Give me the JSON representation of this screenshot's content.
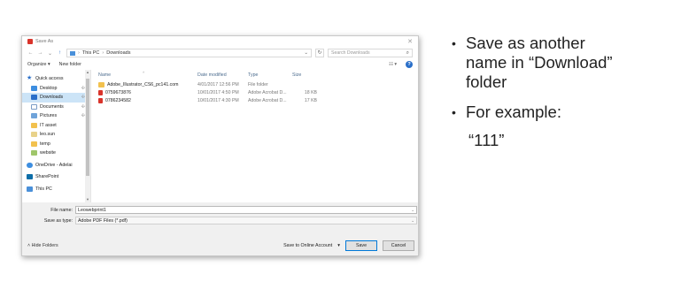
{
  "dialog": {
    "title": "Save As",
    "nav": {
      "back": "←",
      "forward": "→",
      "recent": "⌄",
      "up": "↑",
      "breadcrumb": [
        "This PC",
        "Downloads"
      ],
      "separator": "›",
      "refresh": "↻",
      "search_placeholder": "Search Downloads"
    },
    "toolbar": {
      "organize": "Organize ▾",
      "new_folder": "New folder",
      "view": "☷ ▾",
      "help": "?"
    },
    "sidebar": [
      {
        "label": "Quick access",
        "icon": "star-icon",
        "group": true
      },
      {
        "label": "Desktop",
        "icon": "desktop-icon",
        "pinned": true
      },
      {
        "label": "Downloads",
        "icon": "downloads-icon",
        "pinned": true,
        "selected": true
      },
      {
        "label": "Documents",
        "icon": "documents-icon",
        "pinned": true
      },
      {
        "label": "Pictures",
        "icon": "pictures-icon",
        "pinned": true
      },
      {
        "label": "IT asset",
        "icon": "folder-icon"
      },
      {
        "label": "leo.sun",
        "icon": "user-folder-icon"
      },
      {
        "label": "temp",
        "icon": "folder-icon"
      },
      {
        "label": "website",
        "icon": "web-folder-icon"
      },
      {
        "label": "OneDrive - Adelai",
        "icon": "onedrive-icon",
        "group": true
      },
      {
        "label": "SharePoint",
        "icon": "sharepoint-icon",
        "group": true
      },
      {
        "label": "This PC",
        "icon": "this-pc-icon",
        "group": true
      }
    ],
    "columns": {
      "name": "Name",
      "date": "Date modified",
      "type": "Type",
      "size": "Size"
    },
    "files": [
      {
        "name": "Adobe_Illustrator_CS6_pc141.com",
        "date": "4/01/2017 12:56 PM",
        "type": "File folder",
        "size": "",
        "icon": "folder-icon"
      },
      {
        "name": "0759673876",
        "date": "10/01/2017 4:50 PM",
        "type": "Adobe Acrobat D...",
        "size": "18 KB",
        "icon": "pdf-icon"
      },
      {
        "name": "0786234582",
        "date": "10/01/2017 4:30 PM",
        "type": "Adobe Acrobat D...",
        "size": "17 KB",
        "icon": "pdf-icon"
      }
    ],
    "file_name_label": "File name:",
    "file_name_value": "Leowebprint1",
    "save_type_label": "Save as type:",
    "save_type_value": "Adobe PDF Files (*.pdf)",
    "hide_folders": "Hide Folders",
    "save_online": "Save to Online Account",
    "save_button": "Save",
    "cancel_button": "Cancel"
  },
  "notes": {
    "bullet1": "Save as another\nname in “Download”\nfolder",
    "bullet2": "For example:",
    "example": "“111”"
  }
}
